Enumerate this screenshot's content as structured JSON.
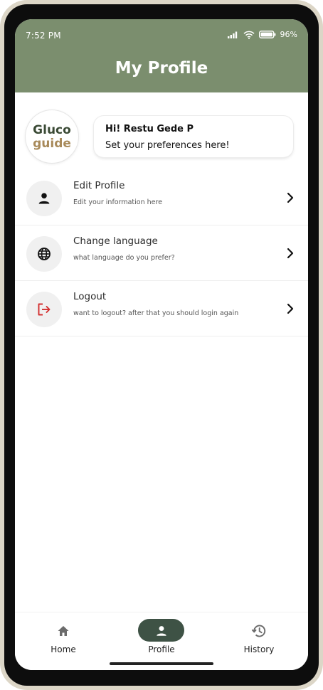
{
  "status_bar": {
    "time": "7:52 PM",
    "battery": "96%"
  },
  "header": {
    "title": "My Profile"
  },
  "logo": {
    "line1": "Gluco",
    "line2": "guide"
  },
  "greeting": {
    "line1": "Hi! Restu Gede P",
    "line2": "Set your preferences here!"
  },
  "menu": [
    {
      "title": "Edit Profile",
      "subtitle": "Edit your information here",
      "icon": "person-icon"
    },
    {
      "title": "Change language",
      "subtitle": "what language do you prefer?",
      "icon": "globe-icon"
    },
    {
      "title": "Logout",
      "subtitle": "want to logout? after that you should login again",
      "icon": "logout-icon",
      "icon_color": "#d32f2f"
    }
  ],
  "nav": [
    {
      "label": "Home",
      "icon": "home-icon",
      "active": false
    },
    {
      "label": "Profile",
      "icon": "person-icon",
      "active": true
    },
    {
      "label": "History",
      "icon": "history-icon",
      "active": false
    }
  ],
  "colors": {
    "header": "#7b8e6e",
    "nav_active": "#3e5245",
    "logout_icon": "#d32f2f"
  }
}
